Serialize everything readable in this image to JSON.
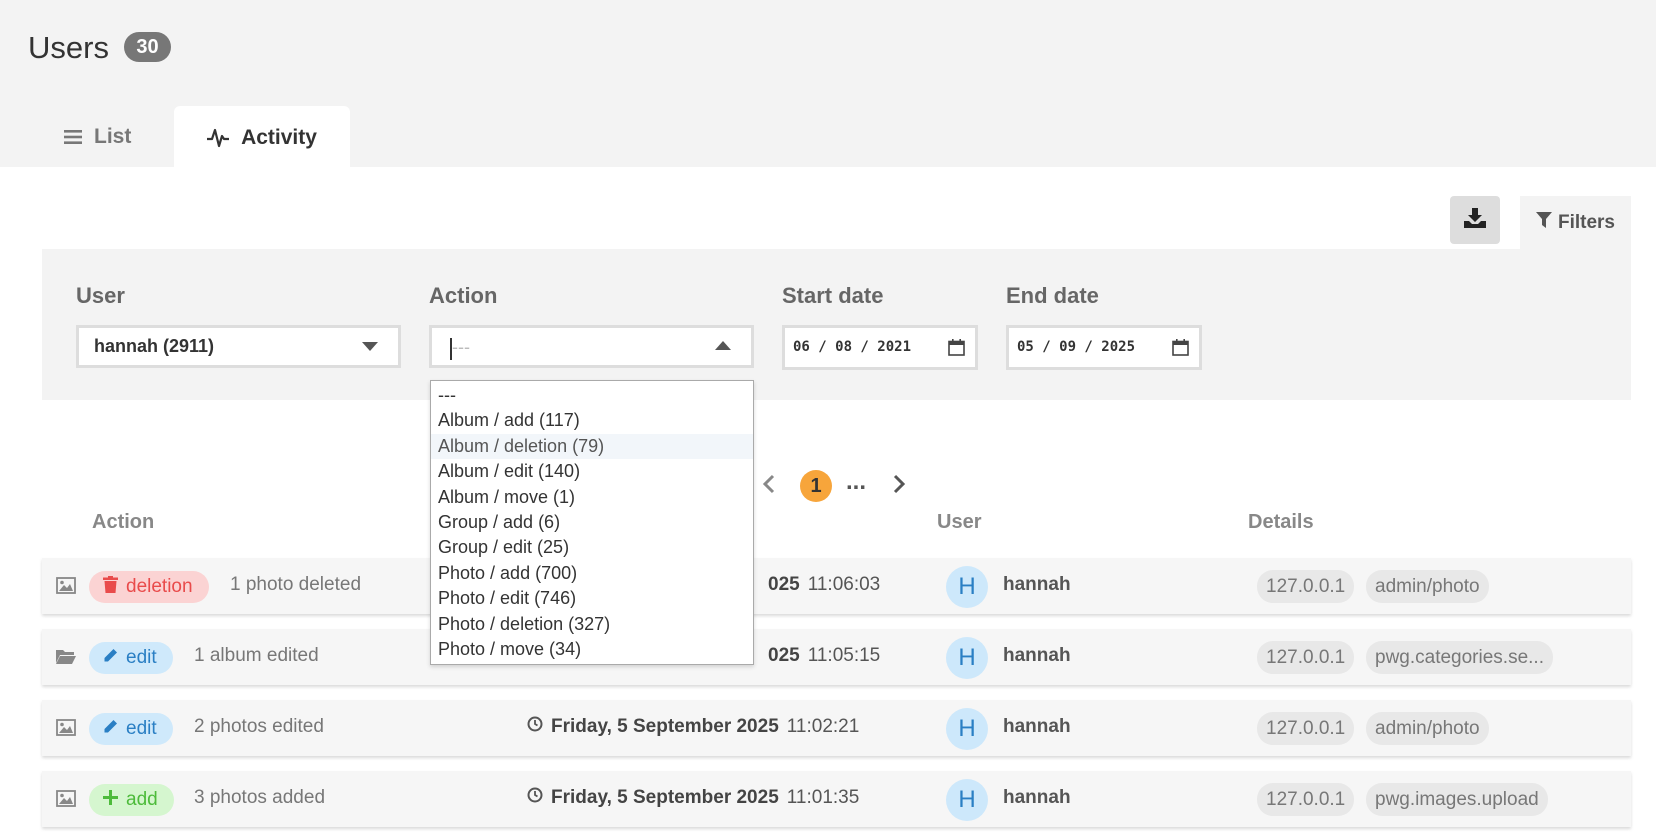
{
  "header": {
    "title": "Users",
    "count": "30"
  },
  "tabs": [
    {
      "label": "List",
      "icon": "list-icon",
      "active": false
    },
    {
      "label": "Activity",
      "icon": "activity-icon",
      "active": true
    }
  ],
  "toolbar": {
    "download_icon": "download-icon",
    "filters_label": "Filters"
  },
  "filters": {
    "user_label": "User",
    "user_value": "hannah (2911)",
    "action_label": "Action",
    "action_placeholder": "---",
    "start_label": "Start date",
    "start_value": "06 / 08 / 2021",
    "end_label": "End date",
    "end_value": "05 / 09 / 2025"
  },
  "action_options": [
    "---",
    "Album / add (117)",
    "Album / deletion (79)",
    "Album / edit (140)",
    "Album / move (1)",
    "Group / add (6)",
    "Group / edit (25)",
    "Photo / add (700)",
    "Photo / edit (746)",
    "Photo / deletion (327)",
    "Photo / move (34)"
  ],
  "highlighted_option": "Album / deletion (79)",
  "pagination": {
    "current": "1",
    "ellipsis": "..."
  },
  "table": {
    "columns": [
      "Action",
      "User",
      "Details"
    ],
    "rows": [
      {
        "type_icon": "image-icon",
        "badge": "deletion",
        "badge_icon": "trash-icon",
        "badge_color": "#e94b4b",
        "summary": "1 photo deleted",
        "date": "025",
        "time": "11:06:03",
        "avatar": "H",
        "user": "hannah",
        "ip": "127.0.0.1",
        "detail": "admin/photo"
      },
      {
        "type_icon": "folder-icon",
        "badge": "edit",
        "badge_icon": "pencil-icon",
        "badge_color": "#2a7fc4",
        "summary": "1 album edited",
        "date": "025",
        "time": "11:05:15",
        "avatar": "H",
        "user": "hannah",
        "ip": "127.0.0.1",
        "detail": "pwg.categories.se..."
      },
      {
        "type_icon": "image-icon",
        "badge": "edit",
        "badge_icon": "pencil-icon",
        "badge_color": "#2a7fc4",
        "summary": "2 photos edited",
        "date": "Friday, 5 September 2025",
        "time": "11:02:21",
        "avatar": "H",
        "user": "hannah",
        "ip": "127.0.0.1",
        "detail": "admin/photo"
      },
      {
        "type_icon": "image-icon",
        "badge": "add",
        "badge_icon": "plus-icon",
        "badge_color": "#4dbb3b",
        "summary": "3 photos added",
        "date": "Friday, 5 September 2025",
        "time": "11:01:35",
        "avatar": "H",
        "user": "hannah",
        "ip": "127.0.0.1",
        "detail": "pwg.images.upload"
      }
    ]
  }
}
